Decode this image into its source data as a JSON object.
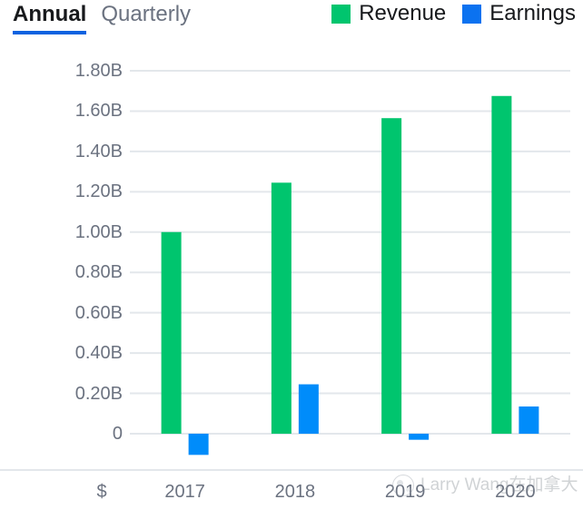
{
  "tabs": [
    {
      "label": "Annual",
      "active": true
    },
    {
      "label": "Quarterly",
      "active": false
    }
  ],
  "legend": [
    {
      "label": "Revenue",
      "color": "#00c56e",
      "icon": "legend-swatch-revenue"
    },
    {
      "label": "Earnings",
      "color": "#0b72f0",
      "icon": "legend-swatch-earnings"
    }
  ],
  "colors": {
    "revenue": "#00c56e",
    "earnings": "#008cfa",
    "legend_revenue": "#00c56e",
    "legend_earnings": "#0b72f0",
    "gridline": "#e3e7eb",
    "separator": "#e3e7eb",
    "axis_text": "#6b7280",
    "tab_active_text": "#17191c",
    "tab_active_underline": "#0c62e0",
    "tab_inactive_text": "#6b7280",
    "watermark_text": "#8b9299",
    "background": "#ffffff"
  },
  "watermark": {
    "text": "Larry Wang在加拿大",
    "logo": "circular-avatar-logo"
  },
  "currency_label": "$",
  "chart_data": {
    "type": "bar",
    "title": "",
    "xlabel": "",
    "ylabel": "",
    "categories": [
      "2017",
      "2018",
      "2019",
      "2020"
    ],
    "series": [
      {
        "name": "Revenue",
        "color": "#00c56e",
        "values": [
          1.0,
          1.245,
          1.565,
          1.675
        ]
      },
      {
        "name": "Earnings",
        "color": "#008cfa",
        "values": [
          -0.105,
          0.245,
          -0.03,
          0.135
        ]
      }
    ],
    "ylim": [
      -0.2,
      1.8
    ],
    "ytick_values": [
      1.8,
      1.6,
      1.4,
      1.2,
      1.0,
      0.8,
      0.6,
      0.4,
      0.2,
      0
    ],
    "ytick_labels": [
      "1.80B",
      "1.60B",
      "1.40B",
      "1.20B",
      "1.00B",
      "0.80B",
      "0.60B",
      "0.40B",
      "0.20B",
      "0"
    ],
    "unit": "B",
    "currency": "$",
    "grid": true,
    "grid_axis": "y",
    "legend_position": "top-right",
    "period": "Annual"
  }
}
